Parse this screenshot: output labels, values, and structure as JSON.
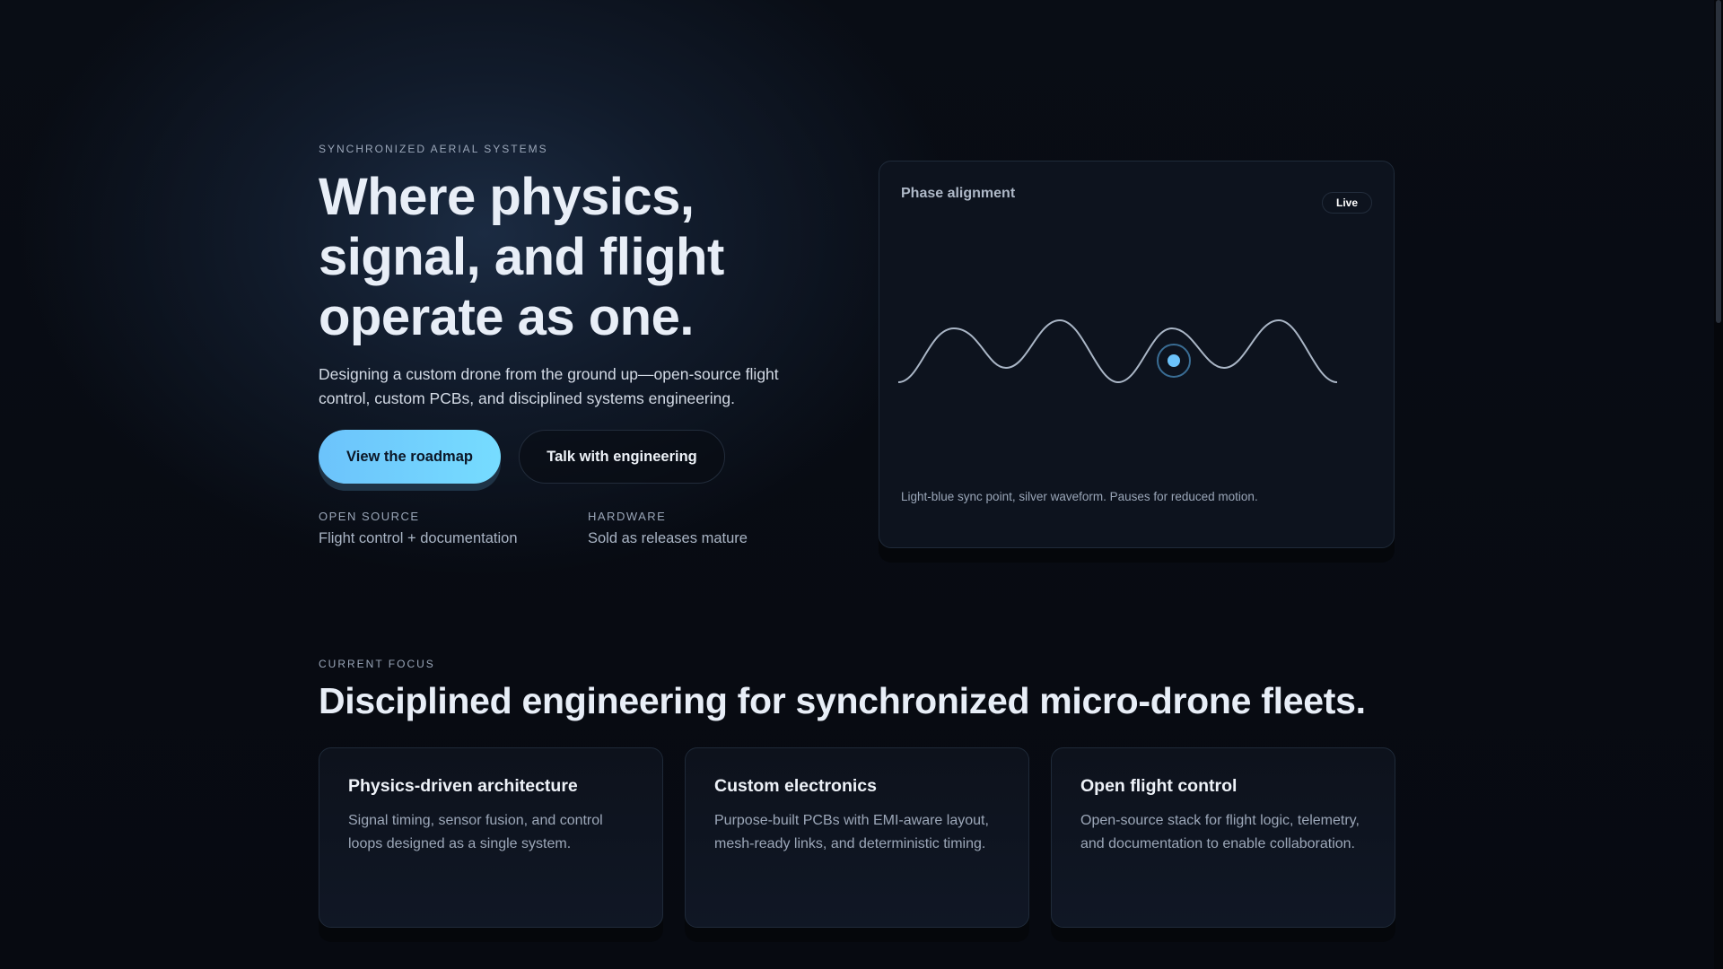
{
  "hero": {
    "eyebrow": "SYNCHRONIZED AERIAL SYSTEMS",
    "title": "Where physics, signal, and flight operate as one.",
    "lead": "Designing a custom drone from the ground up—open-source flight control, custom PCBs, and disciplined systems engineering.",
    "primary_button": "View the roadmap",
    "secondary_button": "Talk with engineering",
    "meta": [
      {
        "label": "OPEN SOURCE",
        "value": "Flight control + documentation"
      },
      {
        "label": "HARDWARE",
        "value": "Sold as releases mature"
      }
    ]
  },
  "panel": {
    "title": "Phase alignment",
    "badge": "Live",
    "caption": "Light-blue sync point, silver waveform. Pauses for reduced motion.",
    "colors": {
      "wave": "#aab6c6",
      "sync_point": "#6cc3fb"
    }
  },
  "focus": {
    "eyebrow": "CURRENT FOCUS",
    "title": "Disciplined engineering for synchronized micro-drone fleets.",
    "cards": [
      {
        "title": "Physics-driven architecture",
        "body": "Signal timing, sensor fusion, and control loops designed as a single system."
      },
      {
        "title": "Custom electronics",
        "body": "Purpose-built PCBs with EMI-aware layout, mesh-ready links, and deterministic timing."
      },
      {
        "title": "Open flight control",
        "body": "Open-source stack for flight logic, telemetry, and documentation to enable collaboration."
      }
    ]
  }
}
